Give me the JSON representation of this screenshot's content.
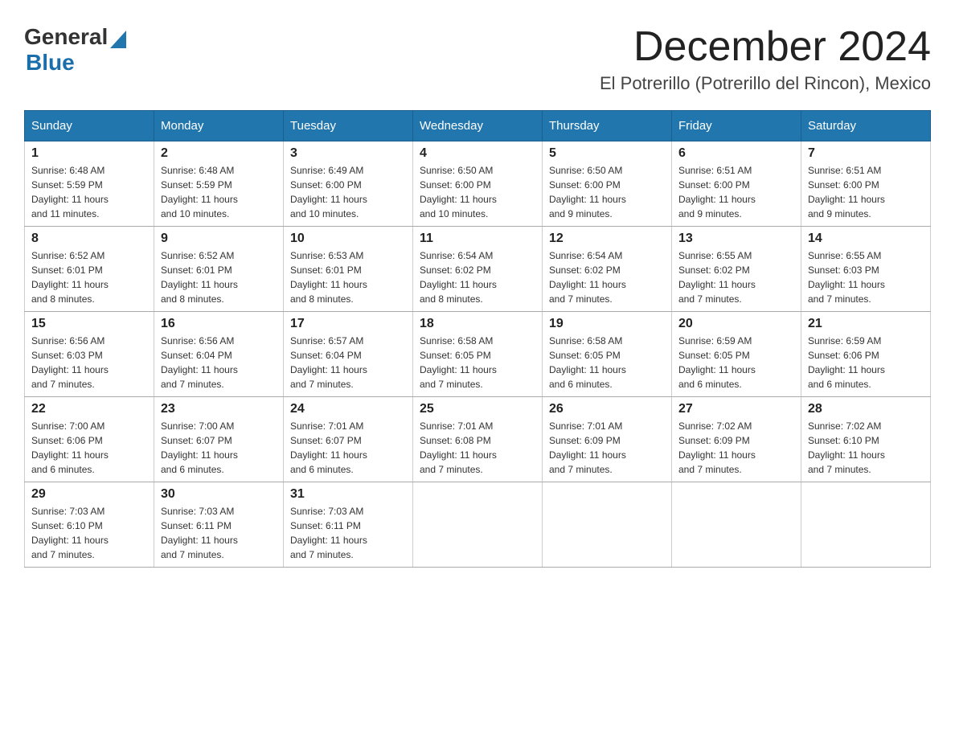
{
  "logo": {
    "general": "General",
    "blue": "Blue"
  },
  "header": {
    "title": "December 2024",
    "subtitle": "El Potrerillo (Potrerillo del Rincon), Mexico"
  },
  "days_of_week": [
    "Sunday",
    "Monday",
    "Tuesday",
    "Wednesday",
    "Thursday",
    "Friday",
    "Saturday"
  ],
  "weeks": [
    [
      {
        "day": "1",
        "sunrise": "6:48 AM",
        "sunset": "5:59 PM",
        "daylight": "11 hours and 11 minutes."
      },
      {
        "day": "2",
        "sunrise": "6:48 AM",
        "sunset": "5:59 PM",
        "daylight": "11 hours and 10 minutes."
      },
      {
        "day": "3",
        "sunrise": "6:49 AM",
        "sunset": "6:00 PM",
        "daylight": "11 hours and 10 minutes."
      },
      {
        "day": "4",
        "sunrise": "6:50 AM",
        "sunset": "6:00 PM",
        "daylight": "11 hours and 10 minutes."
      },
      {
        "day": "5",
        "sunrise": "6:50 AM",
        "sunset": "6:00 PM",
        "daylight": "11 hours and 9 minutes."
      },
      {
        "day": "6",
        "sunrise": "6:51 AM",
        "sunset": "6:00 PM",
        "daylight": "11 hours and 9 minutes."
      },
      {
        "day": "7",
        "sunrise": "6:51 AM",
        "sunset": "6:00 PM",
        "daylight": "11 hours and 9 minutes."
      }
    ],
    [
      {
        "day": "8",
        "sunrise": "6:52 AM",
        "sunset": "6:01 PM",
        "daylight": "11 hours and 8 minutes."
      },
      {
        "day": "9",
        "sunrise": "6:52 AM",
        "sunset": "6:01 PM",
        "daylight": "11 hours and 8 minutes."
      },
      {
        "day": "10",
        "sunrise": "6:53 AM",
        "sunset": "6:01 PM",
        "daylight": "11 hours and 8 minutes."
      },
      {
        "day": "11",
        "sunrise": "6:54 AM",
        "sunset": "6:02 PM",
        "daylight": "11 hours and 8 minutes."
      },
      {
        "day": "12",
        "sunrise": "6:54 AM",
        "sunset": "6:02 PM",
        "daylight": "11 hours and 7 minutes."
      },
      {
        "day": "13",
        "sunrise": "6:55 AM",
        "sunset": "6:02 PM",
        "daylight": "11 hours and 7 minutes."
      },
      {
        "day": "14",
        "sunrise": "6:55 AM",
        "sunset": "6:03 PM",
        "daylight": "11 hours and 7 minutes."
      }
    ],
    [
      {
        "day": "15",
        "sunrise": "6:56 AM",
        "sunset": "6:03 PM",
        "daylight": "11 hours and 7 minutes."
      },
      {
        "day": "16",
        "sunrise": "6:56 AM",
        "sunset": "6:04 PM",
        "daylight": "11 hours and 7 minutes."
      },
      {
        "day": "17",
        "sunrise": "6:57 AM",
        "sunset": "6:04 PM",
        "daylight": "11 hours and 7 minutes."
      },
      {
        "day": "18",
        "sunrise": "6:58 AM",
        "sunset": "6:05 PM",
        "daylight": "11 hours and 7 minutes."
      },
      {
        "day": "19",
        "sunrise": "6:58 AM",
        "sunset": "6:05 PM",
        "daylight": "11 hours and 6 minutes."
      },
      {
        "day": "20",
        "sunrise": "6:59 AM",
        "sunset": "6:05 PM",
        "daylight": "11 hours and 6 minutes."
      },
      {
        "day": "21",
        "sunrise": "6:59 AM",
        "sunset": "6:06 PM",
        "daylight": "11 hours and 6 minutes."
      }
    ],
    [
      {
        "day": "22",
        "sunrise": "7:00 AM",
        "sunset": "6:06 PM",
        "daylight": "11 hours and 6 minutes."
      },
      {
        "day": "23",
        "sunrise": "7:00 AM",
        "sunset": "6:07 PM",
        "daylight": "11 hours and 6 minutes."
      },
      {
        "day": "24",
        "sunrise": "7:01 AM",
        "sunset": "6:07 PM",
        "daylight": "11 hours and 6 minutes."
      },
      {
        "day": "25",
        "sunrise": "7:01 AM",
        "sunset": "6:08 PM",
        "daylight": "11 hours and 7 minutes."
      },
      {
        "day": "26",
        "sunrise": "7:01 AM",
        "sunset": "6:09 PM",
        "daylight": "11 hours and 7 minutes."
      },
      {
        "day": "27",
        "sunrise": "7:02 AM",
        "sunset": "6:09 PM",
        "daylight": "11 hours and 7 minutes."
      },
      {
        "day": "28",
        "sunrise": "7:02 AM",
        "sunset": "6:10 PM",
        "daylight": "11 hours and 7 minutes."
      }
    ],
    [
      {
        "day": "29",
        "sunrise": "7:03 AM",
        "sunset": "6:10 PM",
        "daylight": "11 hours and 7 minutes."
      },
      {
        "day": "30",
        "sunrise": "7:03 AM",
        "sunset": "6:11 PM",
        "daylight": "11 hours and 7 minutes."
      },
      {
        "day": "31",
        "sunrise": "7:03 AM",
        "sunset": "6:11 PM",
        "daylight": "11 hours and 7 minutes."
      },
      null,
      null,
      null,
      null
    ]
  ],
  "labels": {
    "sunrise": "Sunrise:",
    "sunset": "Sunset:",
    "daylight": "Daylight:"
  }
}
